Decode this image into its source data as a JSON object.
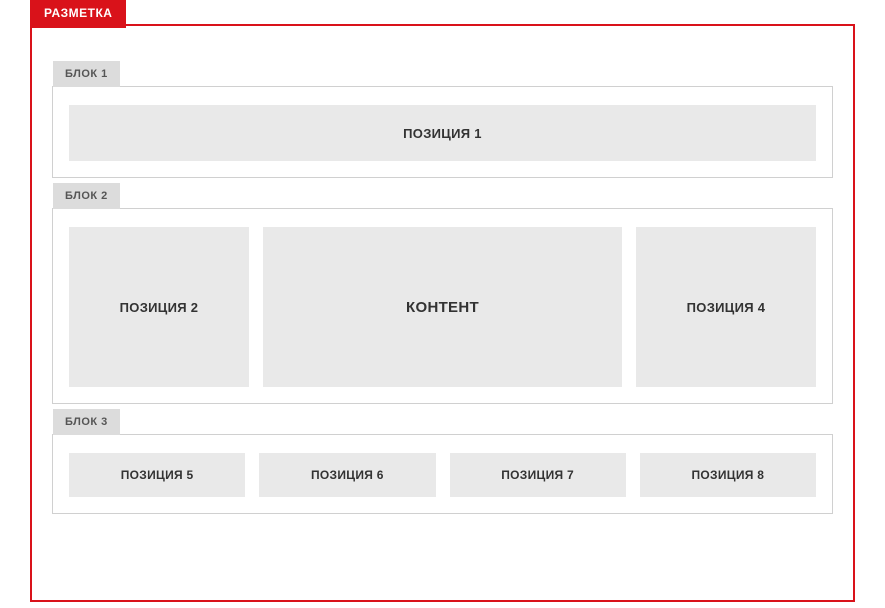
{
  "main_tab": "РАЗМЕТКА",
  "blocks": [
    {
      "label": "БЛОК 1",
      "cells": [
        "ПОЗИЦИЯ 1"
      ]
    },
    {
      "label": "БЛОК 2",
      "cells": [
        "ПОЗИЦИЯ 2",
        "КОНТЕНТ",
        "ПОЗИЦИЯ 4"
      ]
    },
    {
      "label": "БЛОК 3",
      "cells": [
        "ПОЗИЦИЯ 5",
        "ПОЗИЦИЯ 6",
        "ПОЗИЦИЯ 7",
        "ПОЗИЦИЯ 8"
      ]
    }
  ]
}
